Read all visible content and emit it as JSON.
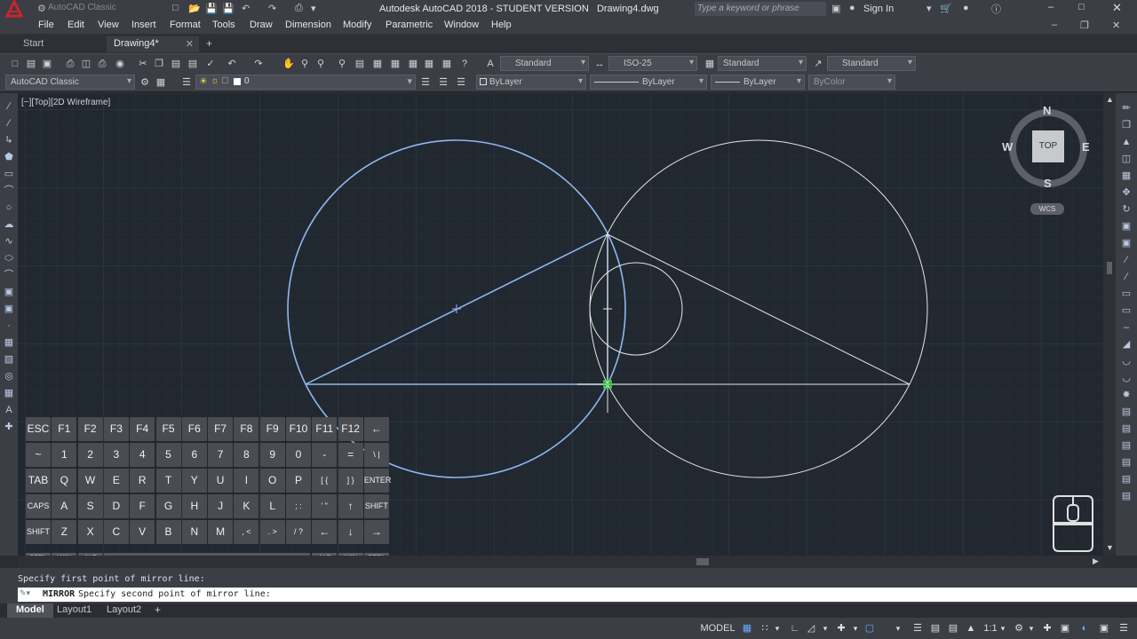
{
  "window": {
    "title": "Autodesk AutoCAD 2018 - STUDENT VERSION",
    "filename": "Drawing4.dwg",
    "workspace_quick": "AutoCAD Classic",
    "search_placeholder": "Type a keyword or phrase",
    "sign_in": "Sign In"
  },
  "menu": [
    "File",
    "Edit",
    "View",
    "Insert",
    "Format",
    "Tools",
    "Draw",
    "Dimension",
    "Modify",
    "Parametric",
    "Window",
    "Help"
  ],
  "tabs": [
    {
      "label": "Start"
    },
    {
      "label": "Drawing4*"
    }
  ],
  "styles": {
    "text_style": "Standard",
    "dim_style": "ISO-25",
    "table_style": "Standard",
    "mleader_style": "Standard"
  },
  "properties": {
    "workspace": "AutoCAD Classic",
    "layer": "0",
    "color": "ByLayer",
    "linetype": "ByLayer",
    "lineweight": "ByLayer",
    "plotstyle": "ByColor"
  },
  "viewport": {
    "label": "[−][Top][2D Wireframe]"
  },
  "viewcube": {
    "north": "N",
    "south": "S",
    "east": "E",
    "west": "W",
    "face": "TOP",
    "ucs": "WCS"
  },
  "keyboard": {
    "row1": [
      "ESC",
      "F1",
      "F2",
      "F3",
      "F4",
      "F5",
      "F6",
      "F7",
      "F8",
      "F9",
      "F10",
      "F11",
      "F12",
      "←"
    ],
    "row2": [
      "~",
      "1",
      "2",
      "3",
      "4",
      "5",
      "6",
      "7",
      "8",
      "9",
      "0",
      "-",
      "=",
      "\\ |"
    ],
    "row3": [
      "TAB",
      "Q",
      "W",
      "E",
      "R",
      "T",
      "Y",
      "U",
      "I",
      "O",
      "P",
      "[ {",
      "] }",
      "ENTER"
    ],
    "row4": [
      "CAPS",
      "A",
      "S",
      "D",
      "F",
      "G",
      "H",
      "J",
      "K",
      "L",
      "; :",
      "' \"",
      "↑",
      "SHIFT"
    ],
    "row5": [
      "SHIFT",
      "Z",
      "X",
      "C",
      "V",
      "B",
      "N",
      "M",
      ", <",
      ". >",
      "/ ?",
      "←",
      "↓",
      "→"
    ],
    "row6_left": [
      "CTRL",
      "WIN",
      "ALT"
    ],
    "row6_right": [
      "ALT",
      "WIN",
      "CTRL"
    ]
  },
  "command": {
    "history": "Specify first point of mirror line:",
    "prompt_command": "MIRROR",
    "prompt_text": "Specify second point of mirror line:"
  },
  "layout_tabs": [
    "Model",
    "Layout1",
    "Layout2"
  ],
  "status": {
    "model": "MODEL",
    "scale": "1:1"
  },
  "colors": {
    "accent_red": "#c8262b",
    "canvas_bg": "#212830",
    "selected_blue": "#8fb7f0",
    "snap_green": "#3adf3a"
  }
}
